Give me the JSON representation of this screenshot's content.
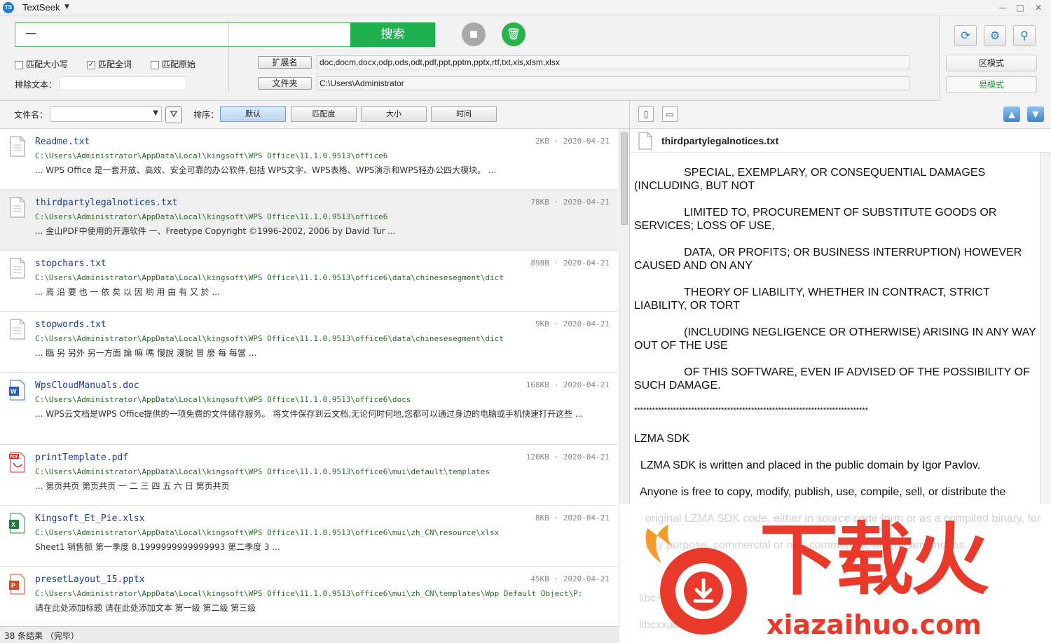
{
  "window": {
    "app_icon_text": "TS",
    "title": "TextSeek",
    "minimize": "—",
    "maximize": "□",
    "close": "✕"
  },
  "search": {
    "query": "一",
    "button_label": "搜索"
  },
  "options": {
    "match_case_label": "匹配大小写",
    "match_case_checked": false,
    "match_whole_word_label": "匹配全词",
    "match_whole_word_checked": true,
    "match_original_label": "匹配原始",
    "match_original_checked": false,
    "exclude_text_label": "排除文本：",
    "exclude_text_value": ""
  },
  "scope": {
    "extensions_button": "扩展名",
    "extensions_value": "doc,docm,docx,odp,ods,odt,pdf,ppt,pptm,pptx,rtf,txt,xls,xlsm,xlsx",
    "folder_button": "文件夹",
    "folder_value": "C:\\Users\\Administrator"
  },
  "mode": {
    "mode_a": "区模式",
    "mode_b": "易模式"
  },
  "filter": {
    "filename_label": "文件名：",
    "filename_value": "",
    "sort_label": "排序：",
    "sort_options": [
      "默认",
      "匹配度",
      "大小",
      "时间"
    ],
    "sort_active": "默认"
  },
  "results": [
    {
      "name": "Readme.txt",
      "type": "txt",
      "size": "2KB",
      "date": "2020-04-21",
      "path": "C:\\Users\\Administrator\\AppData\\Local\\kingsoft\\WPS Office\\11.1.0.9513\\office6",
      "snippet": "... WPS Office 是一套开放、高效、安全可靠的办公软件,包括 WPS文字、WPS表格、WPS演示和WPS轻办公四大模块。 ..."
    },
    {
      "name": "thirdpartylegalnotices.txt",
      "type": "txt",
      "size": "78KB",
      "date": "2020-04-21",
      "path": "C:\\Users\\Administrator\\AppData\\Local\\kingsoft\\WPS Office\\11.1.0.9513\\office6",
      "snippet": "... 金山PDF中使用的开源软件 一、Freetype Copyright ©1996-2002, 2006 by David Tur ..."
    },
    {
      "name": "stopchars.txt",
      "type": "txt",
      "size": "898B",
      "date": "2020-04-21",
      "path": "C:\\Users\\Administrator\\AppData\\Local\\kingsoft\\WPS Office\\11.1.0.9513\\office6\\data\\chinesesegment\\dict",
      "snippet": "... 焉 沿 要 也 一 依 矣 以 因 哟 用 由 有 又 於 ..."
    },
    {
      "name": "stopwords.txt",
      "type": "txt",
      "size": "9KB",
      "date": "2020-04-21",
      "path": "C:\\Users\\Administrator\\AppData\\Local\\kingsoft\\WPS Office\\11.1.0.9513\\office6\\data\\chinesesegment\\dict",
      "snippet": "... 臨 另 另外 另一方面 論 嘛 嗎 慢說 漫說 冒 麼 每 每當 ..."
    },
    {
      "name": "WpsCloudManuals.doc",
      "type": "doc",
      "size": "168KB",
      "date": "2020-04-21",
      "path": "C:\\Users\\Administrator\\AppData\\Local\\kingsoft\\WPS Office\\11.1.0.9513\\office6\\docs",
      "snippet": "... WPS云文档是WPS Office提供的一项免费的文件储存服务。 将文件保存到云文档,无论何时何地,您都可以通过身边的电脑或手机快速打开这些 ..."
    },
    {
      "name": "printTemplate.pdf",
      "type": "pdf",
      "size": "120KB",
      "date": "2020-04-21",
      "path": "C:\\Users\\Administrator\\AppData\\Local\\kingsoft\\WPS Office\\11.1.0.9513\\office6\\mui\\default\\templates",
      "snippet": "... 第页共页 第页共页 一 二 三 四 五 六 日 第页共页"
    },
    {
      "name": "Kingsoft_Et_Pie.xlsx",
      "type": "xlsx",
      "size": "8KB",
      "date": "2020-04-21",
      "path": "C:\\Users\\Administrator\\AppData\\Local\\kingsoft\\WPS Office\\11.1.0.9513\\office6\\mui\\zh_CN\\resource\\xlsx",
      "snippet": "Sheet1 销售额 第一季度 8.1999999999999993 第二季度 3 ..."
    },
    {
      "name": "presetLayout_15.pptx",
      "type": "pptx",
      "size": "45KB",
      "date": "2020-04-21",
      "path": "C:\\Users\\Administrator\\AppData\\Local\\kingsoft\\WPS Office\\11.1.0.9513\\office6\\mui\\zh_CN\\templates\\Wpp Default Object\\P:",
      "snippet": "请在此处添加标题 请在此处添加文本 第一级 第二级 第三级"
    }
  ],
  "status": {
    "text": "38 条结果 （完毕）"
  },
  "preview": {
    "filename": "thirdpartylegalnotices.txt",
    "lines": [
      "                SPECIAL, EXEMPLARY, OR CONSEQUENTIAL DAMAGES (INCLUDING, BUT NOT",
      "                LIMITED TO, PROCUREMENT OF SUBSTITUTE GOODS OR SERVICES; LOSS OF USE,",
      "                DATA, OR PROFITS; OR BUSINESS INTERRUPTION) HOWEVER CAUSED AND ON ANY",
      "                THEORY OF LIABILITY, WHETHER IN CONTRACT, STRICT LIABILITY, OR TORT",
      "                (INCLUDING NEGLIGENCE OR OTHERWISE) ARISING IN ANY WAY OUT OF THE USE",
      "                OF THIS SOFTWARE, EVEN IF ADVISED OF THE POSSIBILITY OF SUCH DAMAGE.",
      "******************************************************************************",
      "LZMA SDK",
      "  LZMA SDK is written and placed in the public domain by Igor Pavlov.",
      "  Anyone is free to copy, modify, publish, use, compile, sell, or distribute the",
      "  original LZMA SDK code, either in source code form or as a compiled binary, for",
      "  any purpose, commercial or non-commercial, and by any means.",
      "libc++",
      "libcxxabi"
    ]
  },
  "watermark": {
    "cn": "下载火",
    "en": "xiazaihuo.com"
  },
  "colors": {
    "search_green": "#1fb04f",
    "accent_blue": "#1e7fd6",
    "watermark_red": "#e8392a"
  }
}
